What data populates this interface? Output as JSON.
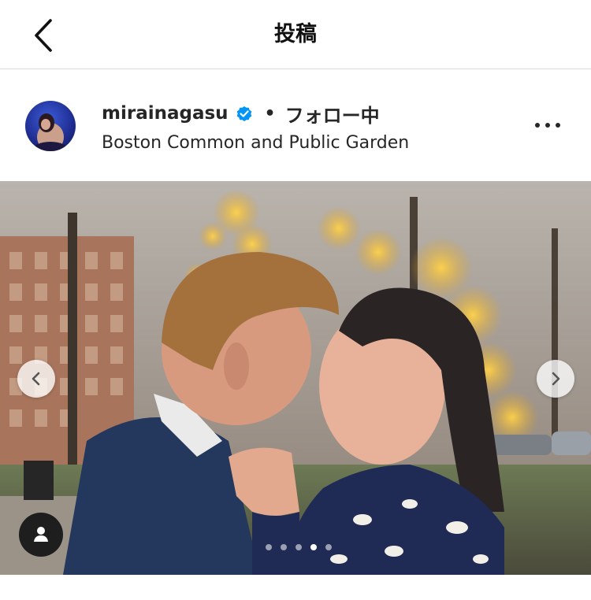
{
  "header": {
    "title": "投稿",
    "back_icon": "chevron-left-icon"
  },
  "post": {
    "username": "mirainagasu",
    "verified": true,
    "verified_color": "#0095f6",
    "separator": "•",
    "follow_status": "フォロー中",
    "location": "Boston Common and Public Garden",
    "more_icon": "more-horizontal-icon"
  },
  "media": {
    "description_icon_prev": "chevron-left-icon",
    "description_icon_next": "chevron-right-icon",
    "tag_icon": "user-tag-icon",
    "carousel_count": 5,
    "carousel_active_index": 3
  }
}
